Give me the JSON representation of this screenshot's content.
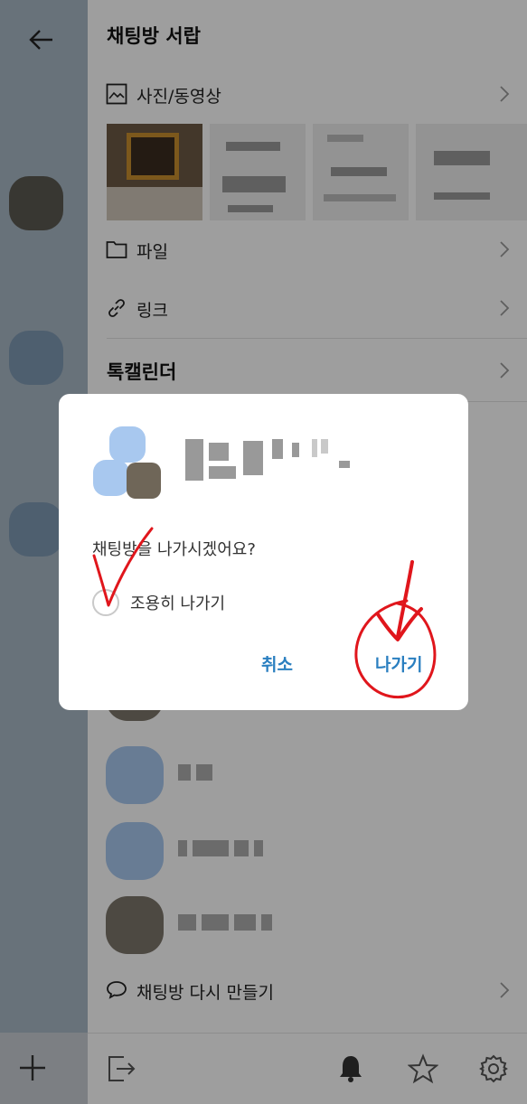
{
  "drawer": {
    "title": "채팅방 서랍",
    "media_label": "사진/동영상",
    "file_label": "파일",
    "link_label": "링크",
    "calendar_label": "톡캘린더",
    "recreate_label": "채팅방 다시 만들기"
  },
  "dialog": {
    "question": "채팅방을 나가시겠어요?",
    "quiet_leave_label": "조용히 나가기",
    "cancel_label": "취소",
    "leave_label": "나가기"
  },
  "colors": {
    "accent": "#2a7fc0",
    "annotation": "#e0161c",
    "default_avatar": "#a8c8ef"
  }
}
